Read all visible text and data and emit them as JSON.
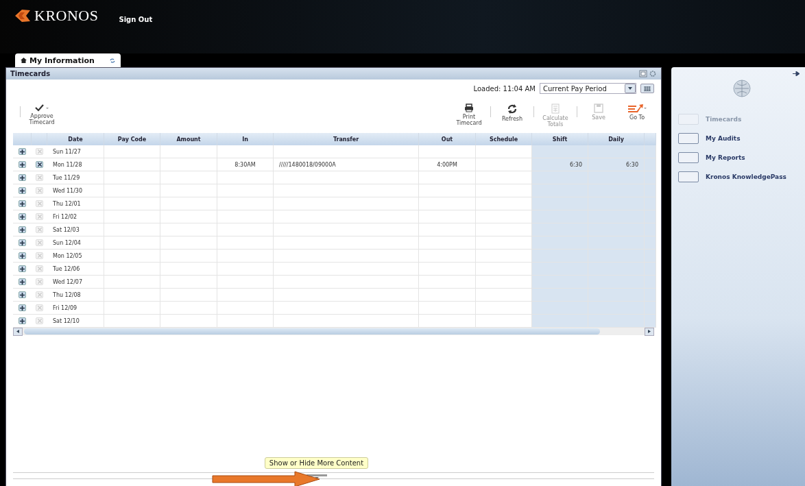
{
  "header": {
    "logo": "KRONOS",
    "sign_out": "Sign Out"
  },
  "tabs": [
    {
      "label": "My Information",
      "selected": true
    }
  ],
  "panel": {
    "title": "Timecards",
    "loaded": "Loaded: 11:04 AM",
    "period": "Current Pay Period"
  },
  "toolbar_left": [
    {
      "label": "Approve Timecard",
      "kind": "approve",
      "disabled": false
    }
  ],
  "toolbar_right": [
    {
      "label": "Print Timecard",
      "kind": "print",
      "disabled": false
    },
    {
      "label": "Refresh",
      "kind": "refresh",
      "disabled": false
    },
    {
      "label": "Calculate Totals",
      "kind": "calculate",
      "disabled": true
    },
    {
      "label": "Save",
      "kind": "save",
      "disabled": true
    },
    {
      "label": "Go To",
      "kind": "goto",
      "disabled": false
    }
  ],
  "table": {
    "columns": [
      "Date",
      "Pay Code",
      "Amount",
      "In",
      "Transfer",
      "Out",
      "Schedule",
      "Shift",
      "Daily"
    ],
    "rows": [
      {
        "date": "Sun 11/27",
        "in": "",
        "transfer": "",
        "out": "",
        "shift": "",
        "daily": "",
        "delete_enabled": false
      },
      {
        "date": "Mon 11/28",
        "in": "8:30AM",
        "transfer": "/////1480018/09000A",
        "out": "4:00PM",
        "shift": "6:30",
        "daily": "6:30",
        "delete_enabled": true
      },
      {
        "date": "Tue 11/29",
        "delete_enabled": false
      },
      {
        "date": "Wed 11/30",
        "delete_enabled": false
      },
      {
        "date": "Thu 12/01",
        "delete_enabled": false
      },
      {
        "date": "Fri 12/02",
        "delete_enabled": false
      },
      {
        "date": "Sat 12/03",
        "delete_enabled": false
      },
      {
        "date": "Sun 12/04",
        "delete_enabled": false
      },
      {
        "date": "Mon 12/05",
        "delete_enabled": false
      },
      {
        "date": "Tue 12/06",
        "delete_enabled": false
      },
      {
        "date": "Wed 12/07",
        "delete_enabled": false
      },
      {
        "date": "Thu 12/08",
        "delete_enabled": false
      },
      {
        "date": "Fri 12/09",
        "delete_enabled": false
      },
      {
        "date": "Sat 12/10",
        "delete_enabled": false
      }
    ]
  },
  "tooltip": "Show or Hide More Content",
  "sidebar": {
    "items": [
      {
        "label": "Timecards",
        "disabled": true
      },
      {
        "label": "My Audits",
        "disabled": false
      },
      {
        "label": "My Reports",
        "disabled": false
      },
      {
        "label": "Kronos KnowledgePass",
        "disabled": false
      }
    ]
  }
}
